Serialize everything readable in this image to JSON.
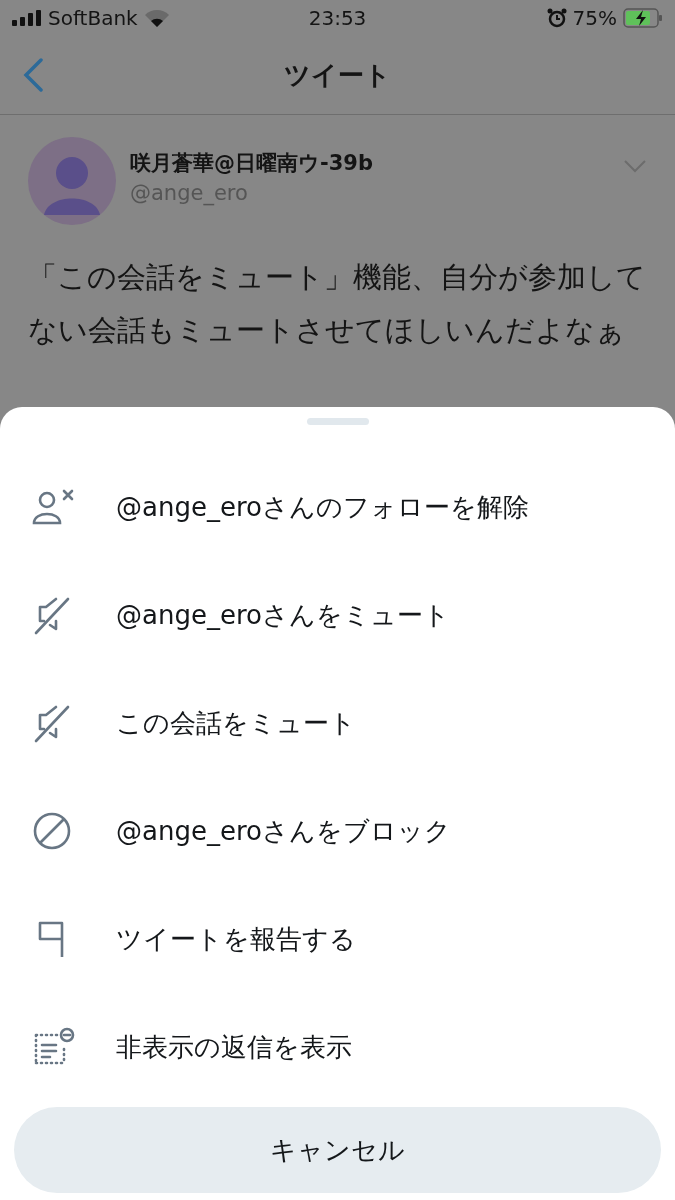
{
  "status_bar": {
    "carrier": "SoftBank",
    "time": "23:53",
    "battery": "75%"
  },
  "nav": {
    "title": "ツイート"
  },
  "tweet": {
    "name": "咲月蒼華@日曜南ウ-39b",
    "handle": "@ange_ero",
    "text": "「この会話をミュート」機能、自分が参加してない会話もミュートさせてほしいんだよなぁ"
  },
  "action_sheet": {
    "items": [
      {
        "kind": "unfollow",
        "label": "@ange_eroさんのフォローを解除"
      },
      {
        "kind": "mute",
        "label": "@ange_eroさんをミュート"
      },
      {
        "kind": "mute",
        "label": "この会話をミュート"
      },
      {
        "kind": "block",
        "label": "@ange_eroさんをブロック"
      },
      {
        "kind": "report",
        "label": "ツイートを報告する"
      },
      {
        "kind": "hidden-replies",
        "label": "非表示の返信を表示"
      }
    ],
    "cancel": "キャンセル"
  }
}
